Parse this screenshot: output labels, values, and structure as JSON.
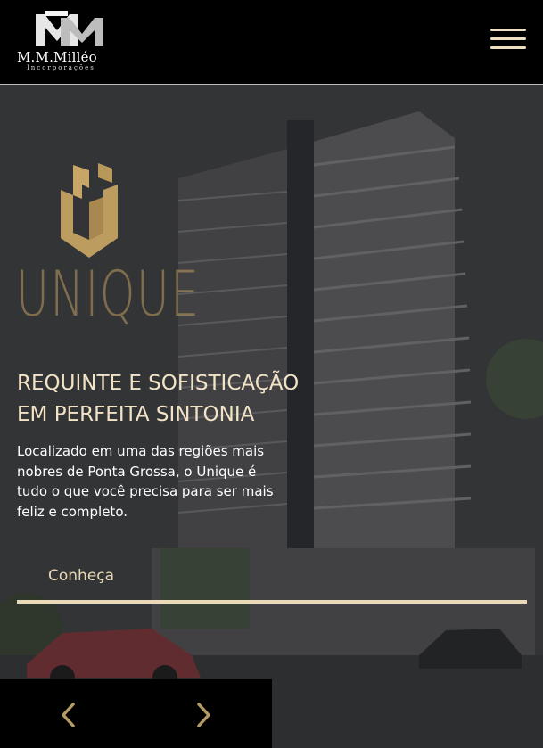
{
  "header": {
    "logo_name": "M.M.Milléo",
    "logo_subtitle": "Incorporações",
    "menu_icon": "hamburger-icon"
  },
  "hero": {
    "brand_name": "UNIQUE",
    "brand_icon": "unique-monogram-icon",
    "headline_line1": "REQUINTE E SOFISTICAÇÃO",
    "headline_line2": "EM PERFEITA SINTONIA",
    "lead": "Localizado em uma das regiões mais nobres de Ponta Grossa, o Unique é tudo o que você precisa para ser mais feliz e completo.",
    "cta_label": "Conheça"
  },
  "slider": {
    "prev_icon": "chevron-left-icon",
    "next_icon": "chevron-right-icon"
  },
  "colors": {
    "accent_gold": "#bd9c60",
    "headline": "#f2e3c6",
    "cta_line": "#e9d9b6",
    "header_bg": "#000000"
  }
}
